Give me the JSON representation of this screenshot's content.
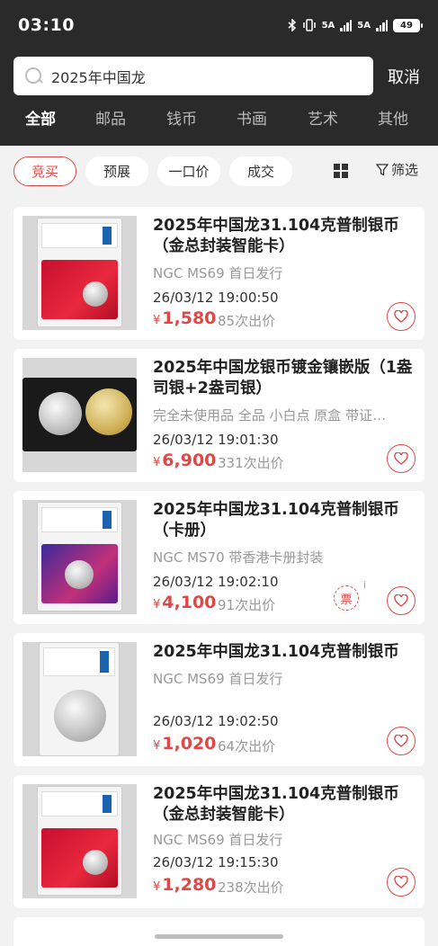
{
  "status_bar": {
    "time": "03:10",
    "signal1": "5A",
    "signal2": "5A",
    "battery": "49"
  },
  "search": {
    "query": "2025年中国龙",
    "cancel_label": "取消"
  },
  "categories": [
    {
      "label": "全部"
    },
    {
      "label": "邮品"
    },
    {
      "label": "钱币"
    },
    {
      "label": "书画"
    },
    {
      "label": "艺术"
    },
    {
      "label": "其他"
    }
  ],
  "filters": {
    "pills": [
      {
        "label": "竞买"
      },
      {
        "label": "预展"
      },
      {
        "label": "一口价"
      },
      {
        "label": "成交"
      }
    ],
    "filter_label": "筛选"
  },
  "listings": [
    {
      "title": "2025年中国龙31.104克普制银币（金总封装智能卡）",
      "subtitle": "NGC MS69 首日发行",
      "date": "26/03/12 19:00:50",
      "currency": "¥",
      "price": "1,580",
      "bids": "85次出价"
    },
    {
      "title": "2025年中国龙银币镀金镶嵌版（1盎司银+2盎司银）",
      "subtitle": "完全未使用品 全品 小白点 原盒 带证…",
      "date": "26/03/12 19:01:30",
      "currency": "¥",
      "price": "6,900",
      "bids": "331次出价"
    },
    {
      "title": "2025年中国龙31.104克普制银币（卡册）",
      "subtitle": "NGC MS70 带香港卡册封装",
      "date": "26/03/12 19:02:10",
      "currency": "¥",
      "price": "4,100",
      "bids": "91次出价",
      "ticket": "票",
      "info": "i"
    },
    {
      "title": "2025年中国龙31.104克普制银币",
      "subtitle": "NGC MS69 首日发行",
      "date": "26/03/12 19:02:50",
      "currency": "¥",
      "price": "1,020",
      "bids": "64次出价"
    },
    {
      "title": "2025年中国龙31.104克普制银币（金总封装智能卡）",
      "subtitle": "NGC MS69 首日发行",
      "date": "26/03/12 19:15:30",
      "currency": "¥",
      "price": "1,280",
      "bids": "238次出价"
    }
  ],
  "colors": {
    "accent": "#e04848",
    "header_bg": "#2a2a2a",
    "page_bg": "#f2f2f2"
  }
}
